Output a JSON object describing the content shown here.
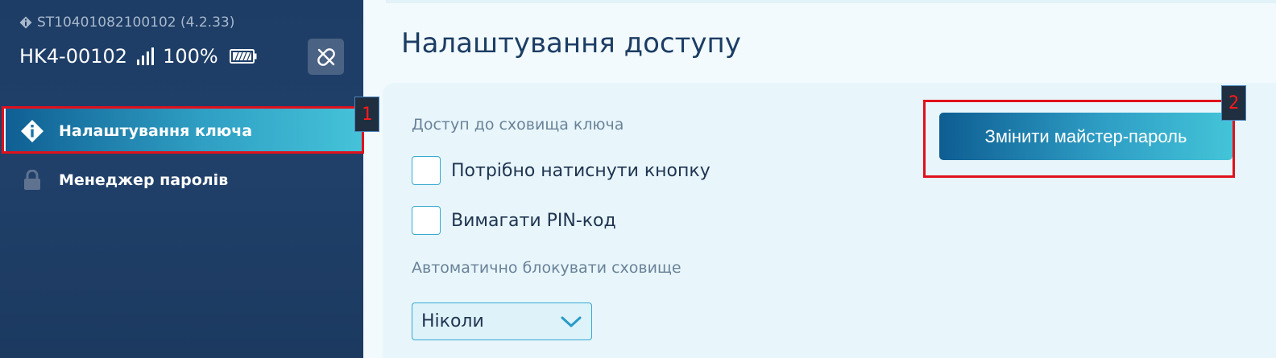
{
  "sidebar": {
    "device_serial": "ST10401082100102 (4.2.33)",
    "device_name": "HK4-00102",
    "battery_percent": "100%",
    "signal_level": 1.0,
    "battery_level": 1.0,
    "items": [
      {
        "label": "Налаштування ключа",
        "icon": "diamond-info-icon",
        "active": true
      },
      {
        "label": "Менеджер паролів",
        "icon": "lock-icon",
        "active": false
      }
    ]
  },
  "main": {
    "title": "Налаштування доступу",
    "storage_access_label": "Доступ до сховища ключа",
    "checkboxes": [
      {
        "label": "Потрібно натиснути кнопку",
        "checked": false
      },
      {
        "label": "Вимагати PIN-код",
        "checked": false
      }
    ],
    "autolock_label": "Автоматично блокувати сховище",
    "autolock_value": "Ніколи",
    "change_password_button": "Змінити майстер-пароль"
  },
  "annotations": {
    "tag1": "1",
    "tag2": "2"
  },
  "colors": {
    "sidebar_bg": "#1f3e68",
    "accent_start": "#0e5d92",
    "accent_end": "#43c4d8",
    "annotation_red": "#e0101c",
    "title_color": "#1c3d64"
  }
}
